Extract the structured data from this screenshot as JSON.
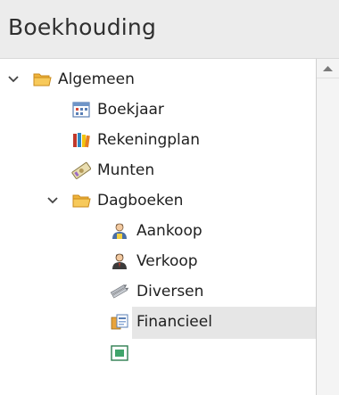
{
  "header": {
    "title": "Boekhouding"
  },
  "tree": {
    "items": [
      {
        "label": "Algemeen",
        "icon": "folder-icon"
      },
      {
        "label": "Boekjaar",
        "icon": "calendar-icon"
      },
      {
        "label": "Rekeningplan",
        "icon": "books-icon"
      },
      {
        "label": "Munten",
        "icon": "banknote-icon"
      },
      {
        "label": "Dagboeken",
        "icon": "folder-icon"
      },
      {
        "label": "Aankoop",
        "icon": "user-icon"
      },
      {
        "label": "Verkoop",
        "icon": "user-dark-icon"
      },
      {
        "label": "Diversen",
        "icon": "pencils-icon"
      },
      {
        "label": "Financieel",
        "icon": "finance-icon"
      }
    ]
  },
  "colors": {
    "header_bg": "#ececec",
    "selected_bg": "#e6e6e6",
    "folder": "#f3b23a",
    "chevron": "#444444"
  }
}
